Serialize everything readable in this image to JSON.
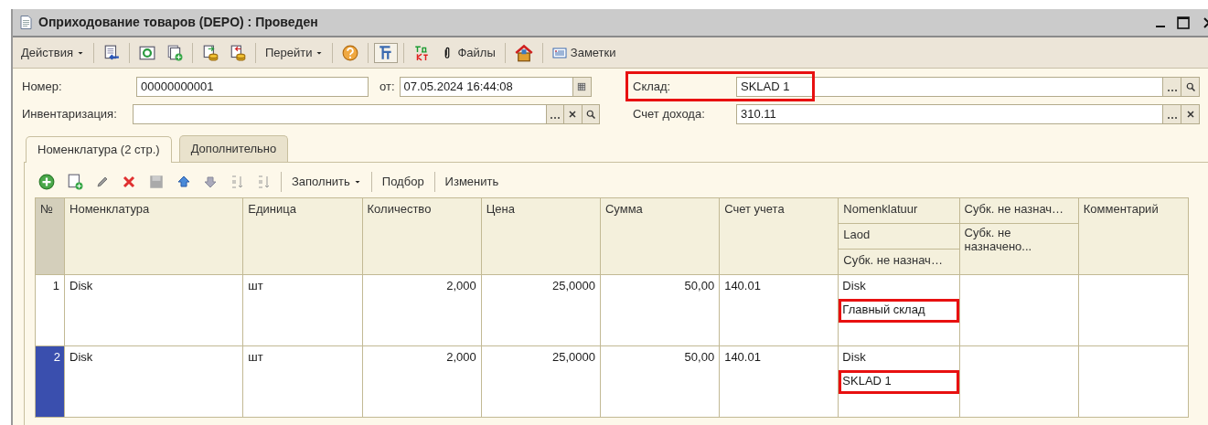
{
  "window": {
    "title": "Оприходование товаров (DEPO) : Проведен"
  },
  "toolbar": {
    "actions_menu": "Действия",
    "goto_menu": "Перейти",
    "kt_toggle_pressed": true,
    "files": "Файлы",
    "notes": "Заметки"
  },
  "header_fields": {
    "number": {
      "label": "Номер:",
      "value": "00000000001"
    },
    "date": {
      "label": "от:",
      "value": "07.05.2024 16:44:08"
    },
    "inventory": {
      "label": "Инвентаризация:"
    },
    "warehouse": {
      "label": "Склад:",
      "value": "SKLAD 1",
      "highlighted": true
    },
    "income_account": {
      "label": "Счет дохода:",
      "value": "310.11"
    }
  },
  "tabs": [
    {
      "label": "Номенклатура (2 стр.)",
      "selected": true
    },
    {
      "label": "Дополнительно",
      "selected": false
    }
  ],
  "table_toolbar": {
    "fill_menu": "Заполнить",
    "pick": "Подбор",
    "change": "Изменить"
  },
  "table": {
    "columns": [
      "№",
      "Номенклатура",
      "Единица",
      "Количество",
      "Цена",
      "Сумма",
      "Счет учета"
    ],
    "subconto_headers": [
      "Nomenklatuur",
      "Laod",
      "Субк. не назнач…"
    ],
    "extra_headers": [
      "Субк. не назнач…",
      "Субк. не назначено..."
    ],
    "comment_header": "Комментарий",
    "rows": [
      {
        "number": "1",
        "selected": false,
        "nomenclature": "Disk",
        "unit": "шт",
        "quantity": "2,000",
        "price": "25,0000",
        "sum": "50,00",
        "account": "140.01",
        "subconto": [
          {
            "text": "Disk",
            "highlighted": false
          },
          {
            "text": "Главный склад",
            "highlighted": true
          }
        ]
      },
      {
        "number": "2",
        "selected": true,
        "nomenclature": "Disk",
        "unit": "шт",
        "quantity": "2,000",
        "price": "25,0000",
        "sum": "50,00",
        "account": "140.01",
        "subconto": [
          {
            "text": "Disk",
            "highlighted": false
          },
          {
            "text": "SKLAD 1",
            "highlighted": true
          }
        ]
      }
    ]
  }
}
